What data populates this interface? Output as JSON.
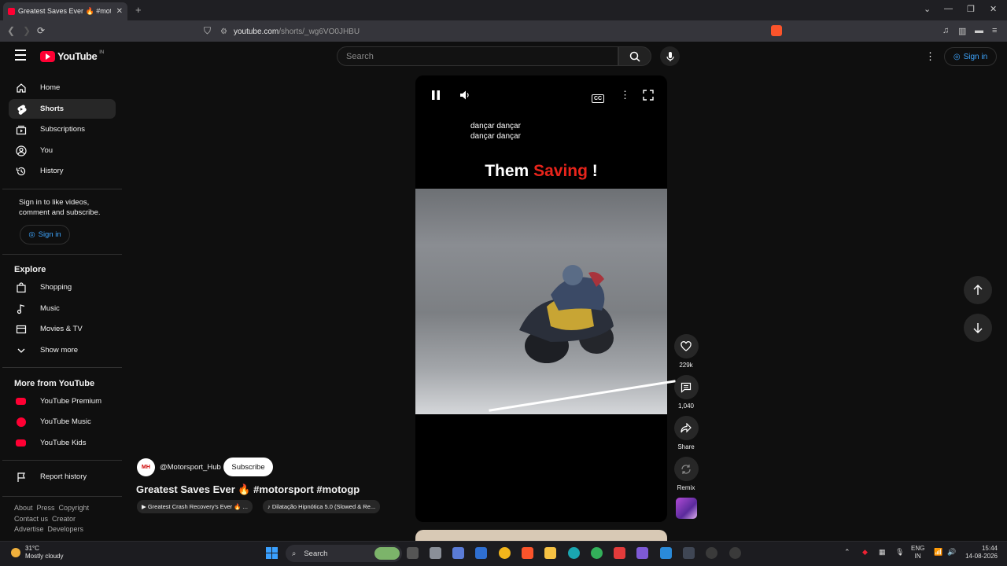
{
  "browser": {
    "tab_title": "Greatest Saves Ever 🔥 #moto",
    "url_host": "youtube.com",
    "url_path": "/shorts/_wg6VO0JHBU"
  },
  "header": {
    "logo_text": "YouTube",
    "country": "IN",
    "search_placeholder": "Search",
    "signin_label": "Sign in"
  },
  "sidebar": {
    "items": [
      {
        "label": "Home",
        "icon": "home-icon"
      },
      {
        "label": "Shorts",
        "icon": "shorts-icon"
      },
      {
        "label": "Subscriptions",
        "icon": "subscriptions-icon"
      },
      {
        "label": "You",
        "icon": "you-icon"
      },
      {
        "label": "History",
        "icon": "history-icon"
      }
    ],
    "signin_prompt": "Sign in to like videos, comment and subscribe.",
    "signin_label": "Sign in",
    "explore_heading": "Explore",
    "explore": [
      {
        "label": "Shopping",
        "icon": "shopping-icon"
      },
      {
        "label": "Music",
        "icon": "music-icon"
      },
      {
        "label": "Movies & TV",
        "icon": "movies-icon"
      },
      {
        "label": "Show more",
        "icon": "chevron-down-icon"
      }
    ],
    "more_heading": "More from YouTube",
    "more": [
      {
        "label": "YouTube Premium"
      },
      {
        "label": "YouTube Music"
      },
      {
        "label": "YouTube Kids"
      }
    ],
    "report_history": "Report history",
    "footer_row1": [
      "About",
      "Press",
      "Copyright"
    ],
    "footer_row2": [
      "Contact us",
      "Creator"
    ],
    "footer_row3": [
      "Advertise",
      "Developers"
    ]
  },
  "player": {
    "lyric_line1": "dançar dançar",
    "lyric_line2": "dançar dançar",
    "caption_word1": "Them",
    "caption_word2": "Saving",
    "caption_word3": "!"
  },
  "short": {
    "channel_avatar_text": "MH",
    "channel": "@Motorsport_Hub",
    "subscribe_label": "Subscribe",
    "title": "Greatest Saves Ever 🔥 #motorsport #motogp",
    "chip_video": "▶ Greatest Crash Recovery's Ever 🔥 ...",
    "chip_audio": "♪ Dilatação Hipnótica 5.0 (Slowed & Re..."
  },
  "actions": {
    "likes": "229k",
    "comments": "1,040",
    "share": "Share",
    "remix": "Remix"
  },
  "taskbar": {
    "temperature": "31°C",
    "weather": "Mostly cloudy",
    "search_label": "Search",
    "lang1": "ENG",
    "lang2": "IN",
    "time": "15:44",
    "date": "14-08-2026"
  },
  "colors": {
    "youtube_red": "#ff0033",
    "link_blue": "#3ea6ff",
    "caption_red": "#e8241b"
  }
}
